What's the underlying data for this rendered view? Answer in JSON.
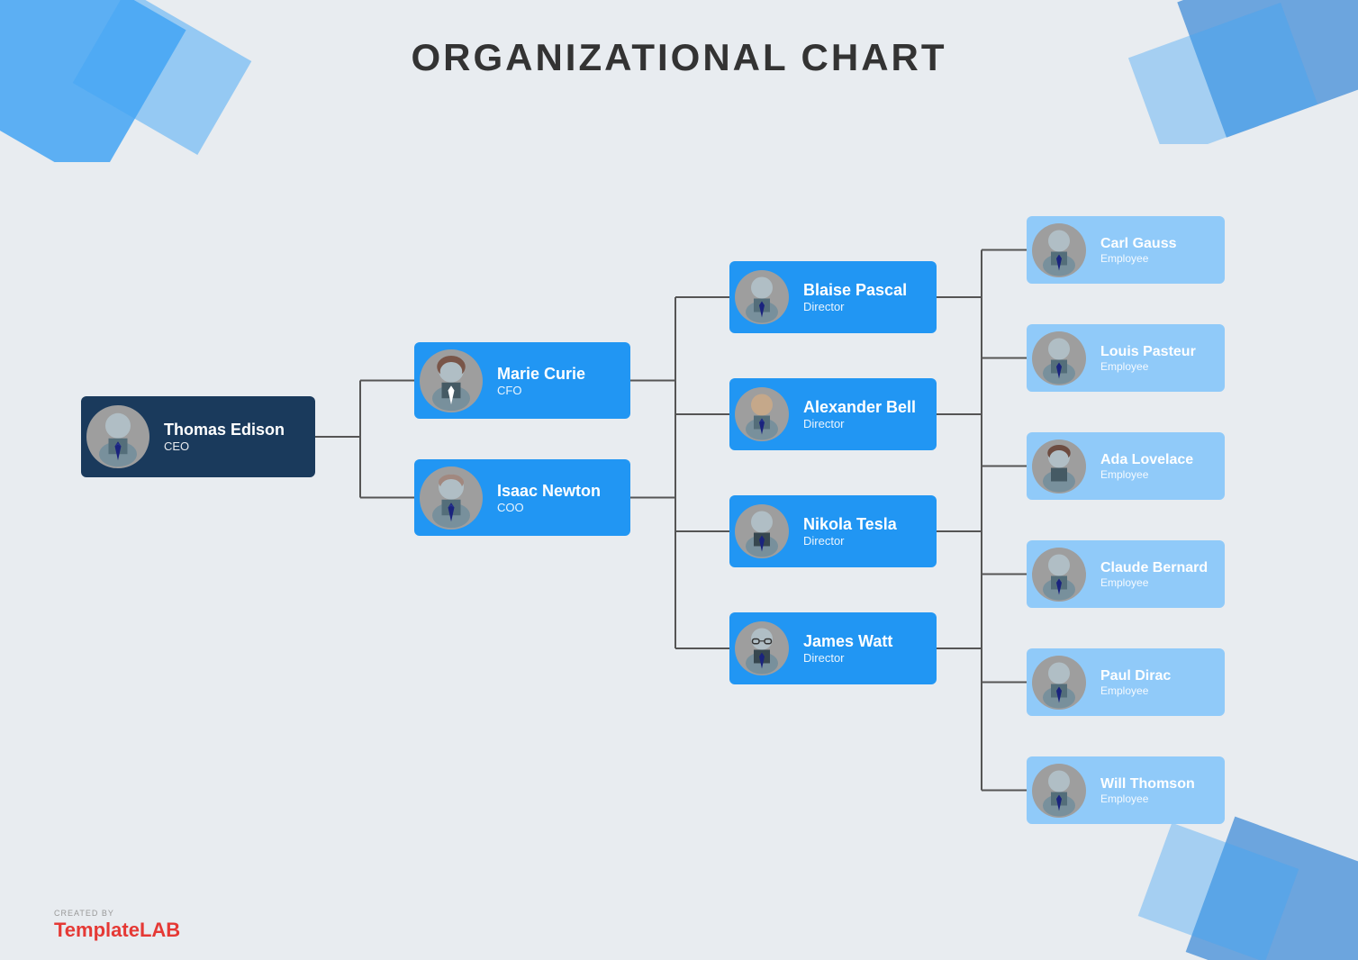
{
  "page": {
    "title": "ORGANIZATIONAL CHART",
    "background_color": "#e8ecf0"
  },
  "nodes": {
    "ceo": {
      "name": "Thomas Edison",
      "role": "CEO",
      "type": "dark-blue"
    },
    "cfo": {
      "name": "Marie Curie",
      "role": "CFO",
      "type": "medium-blue"
    },
    "coo": {
      "name": "Isaac Newton",
      "role": "COO",
      "type": "medium-blue"
    },
    "directors": [
      {
        "name": "Blaise Pascal",
        "role": "Director"
      },
      {
        "name": "Alexander Bell",
        "role": "Director"
      },
      {
        "name": "Nikola Tesla",
        "role": "Director"
      },
      {
        "name": "James Watt",
        "role": "Director"
      }
    ],
    "employees": [
      {
        "name": "Carl Gauss",
        "role": "Employee"
      },
      {
        "name": "Louis Pasteur",
        "role": "Employee"
      },
      {
        "name": "Ada Lovelace",
        "role": "Employee"
      },
      {
        "name": "Claude Bernard",
        "role": "Employee"
      },
      {
        "name": "Paul Dirac",
        "role": "Employee"
      },
      {
        "name": "Will Thomson",
        "role": "Employee"
      }
    ]
  },
  "footer": {
    "created_by": "CREATED BY",
    "brand_template": "Template",
    "brand_lab": "LAB"
  }
}
